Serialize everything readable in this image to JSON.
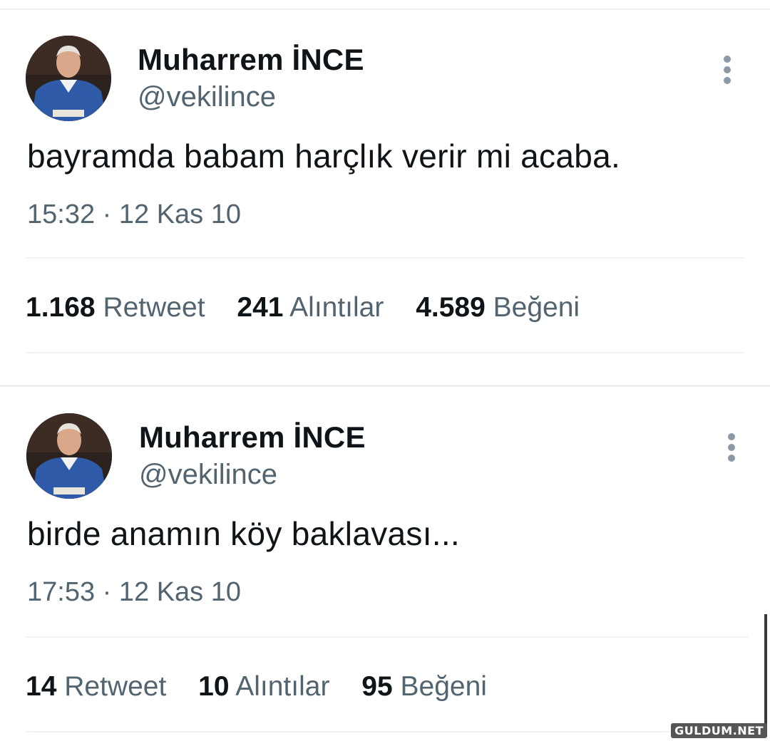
{
  "tweets": [
    {
      "author_name": "Muharrem İNCE",
      "handle": "@vekilince",
      "text": "bayramda babam harçlık verir mi acaba.",
      "time": "15:32 · 12 Kas 10",
      "stats": {
        "retweets": "1.168",
        "retweets_label": "Retweet",
        "quotes": "241",
        "quotes_label": "Alıntılar",
        "likes": "4.589",
        "likes_label": "Beğeni"
      },
      "more_icon": "more-vertical-icon"
    },
    {
      "author_name": "Muharrem İNCE",
      "handle": "@vekilince",
      "text": "birde anamın köy baklavası...",
      "time": "17:53 · 12 Kas 10",
      "stats": {
        "retweets": "14",
        "retweets_label": "Retweet",
        "quotes": "10",
        "quotes_label": "Alıntılar",
        "likes": "95",
        "likes_label": "Beğeni"
      },
      "more_icon": "more-vertical-icon"
    }
  ],
  "watermark": "GULDUM.NET",
  "colors": {
    "text_primary": "#0f1419",
    "text_secondary": "#536471",
    "divider": "#eff3f4",
    "avatar_sweater": "#2f5aa8"
  }
}
